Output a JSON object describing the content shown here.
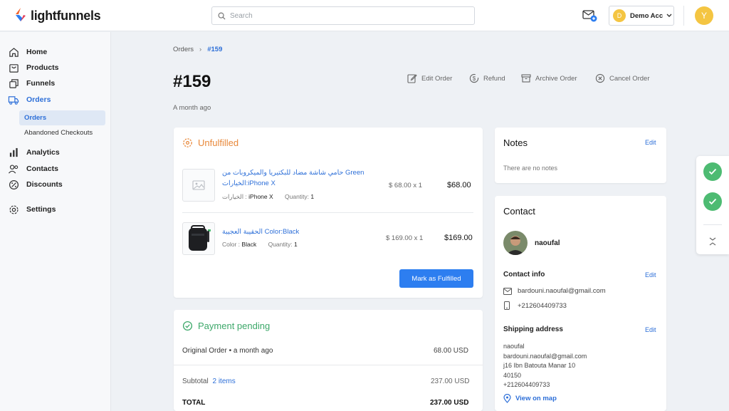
{
  "brand": {
    "name": "lightfunnels",
    "accent": "#2d6fd8",
    "logo_colors": [
      "#f0642e",
      "#2d7ef0",
      "#e23d5a"
    ]
  },
  "header": {
    "search_placeholder": "Search",
    "account_initial": "D",
    "account_name": "Demo Acc",
    "user_initial": "Y"
  },
  "sidebar": {
    "items": [
      {
        "label": "Home",
        "icon": "home-icon"
      },
      {
        "label": "Products",
        "icon": "bag-icon"
      },
      {
        "label": "Funnels",
        "icon": "funnel-icon"
      },
      {
        "label": "Orders",
        "icon": "truck-icon"
      },
      {
        "label": "Analytics",
        "icon": "bar-chart-icon"
      },
      {
        "label": "Contacts",
        "icon": "users-icon"
      },
      {
        "label": "Discounts",
        "icon": "discount-icon"
      },
      {
        "label": "Settings",
        "icon": "gear-icon"
      }
    ],
    "sub_items": [
      "Orders",
      "Abandoned Checkouts"
    ]
  },
  "breadcrumb": {
    "parent": "Orders",
    "sep": "›",
    "current": "#159"
  },
  "order": {
    "title": "#159",
    "subtitle": "A month ago",
    "actions": [
      "Edit Order",
      "Refund",
      "Archive Order",
      "Cancel Order"
    ]
  },
  "unfulfilled": {
    "title": "Unfulfilled",
    "items": [
      {
        "name_line1": "حامي شاشة مضاد للبكتيريا والميكروبات من Green",
        "name_line2": "الخيارات:iPhone X",
        "meta_label1": "الخيارات : ",
        "meta_value1": "iPhone X",
        "meta_label2": "Quantity: ",
        "meta_value2": "1",
        "unit": "$ 68.00 x 1",
        "total": "$68.00"
      },
      {
        "name_line1": "الحقيبة العجيبة Color:Black",
        "meta_label1": "Color : ",
        "meta_value1": "Black",
        "meta_label2": "Quantity: ",
        "meta_value2": "1",
        "unit": "$ 169.00 x 1",
        "total": "$169.00"
      }
    ],
    "button_label": "Mark as Fulfilled"
  },
  "payment": {
    "title": "Payment pending",
    "original_label": "Original Order • a month ago",
    "original_value": "68.00 USD",
    "subtotal_label": "Subtotal",
    "subtotal_items": "2 items",
    "subtotal_value": "237.00 USD",
    "total_label": "TOTAL",
    "total_value": "237.00 USD"
  },
  "notes": {
    "title": "Notes",
    "edit": "Edit",
    "empty": "There are no notes"
  },
  "contact": {
    "title": "Contact",
    "name": "naoufal",
    "info_title": "Contact info",
    "info_edit": "Edit",
    "email": "bardouni.naoufal@gmail.com",
    "phone": "+212604409733",
    "shipping_title": "Shipping address",
    "shipping_edit": "Edit",
    "address_lines": [
      "naoufal",
      "bardouni.naoufal@gmail.com",
      "j16 Ibn Batouta Manar 10",
      "40150",
      "+212604409733"
    ],
    "map_link": "View on map"
  }
}
